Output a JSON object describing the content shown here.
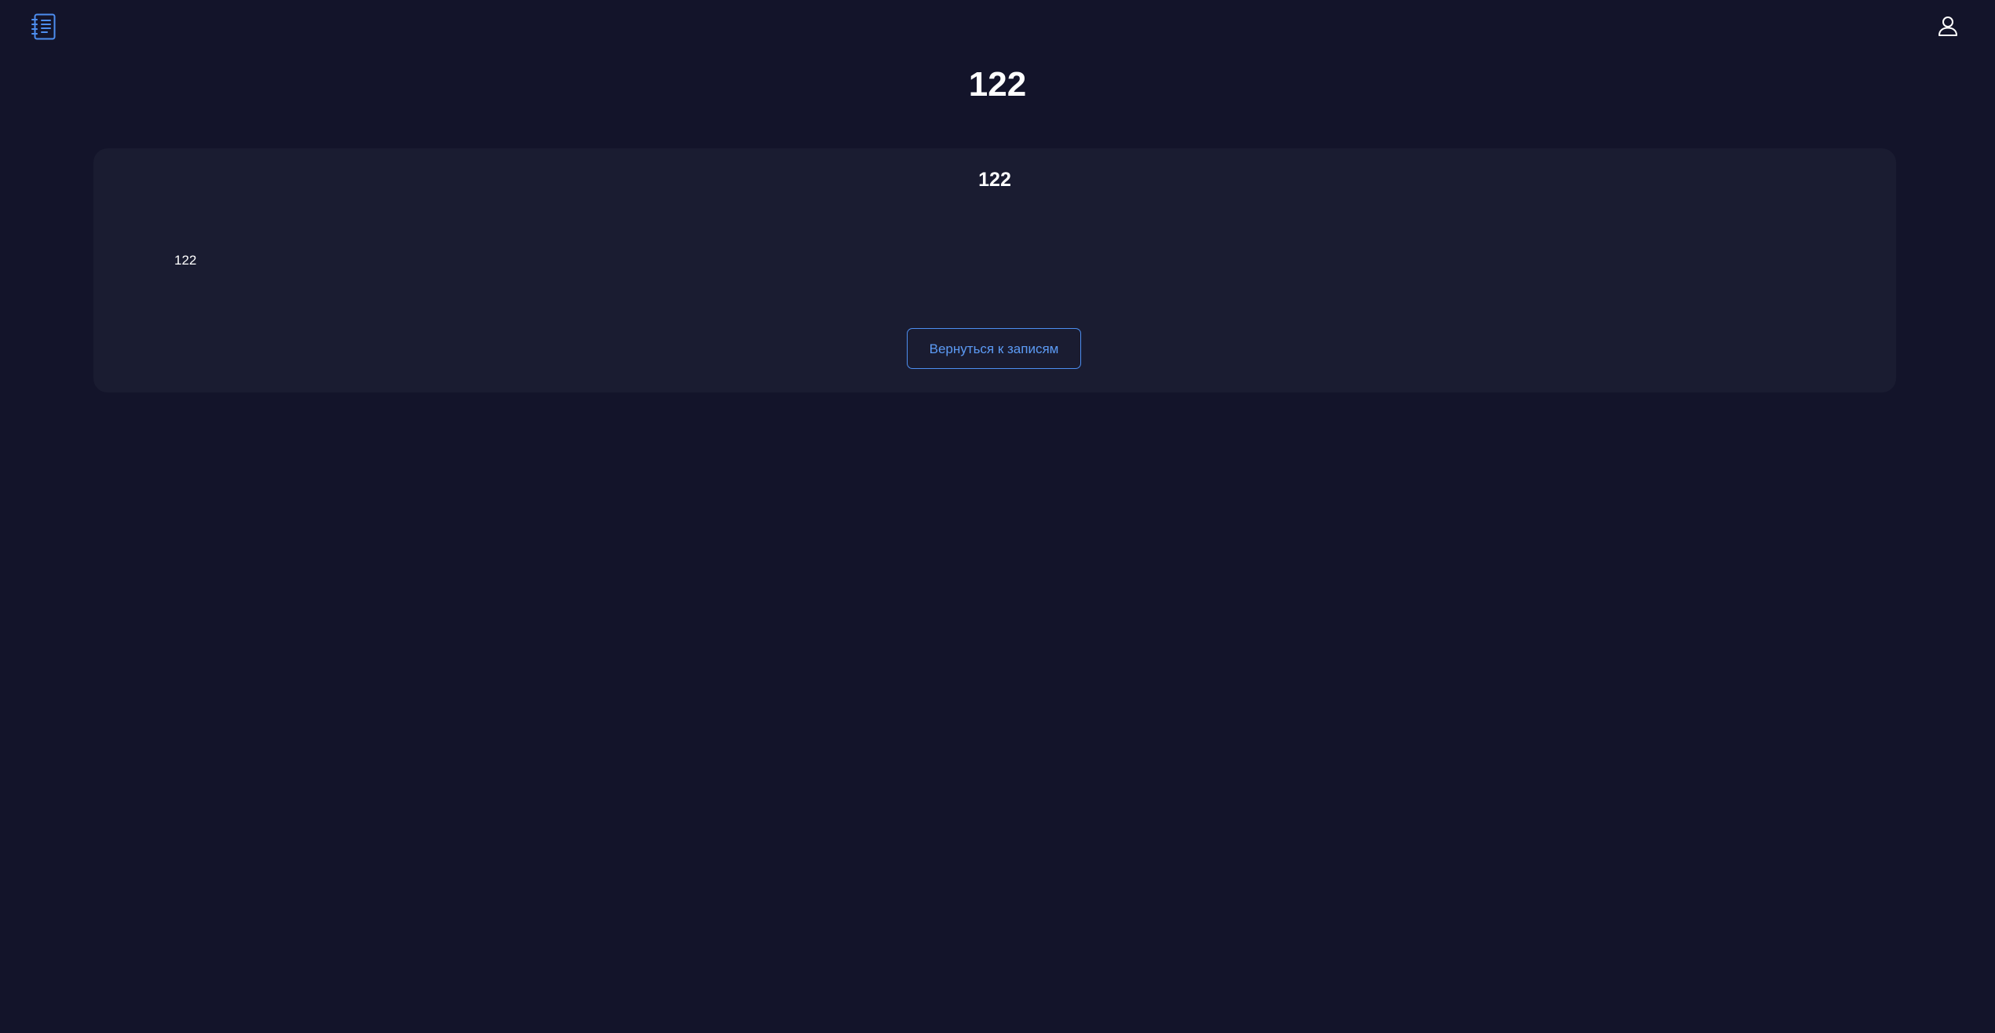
{
  "header": {
    "logo_icon": "notebook-list-icon",
    "profile_icon": "user-profile-icon"
  },
  "page": {
    "title": "122"
  },
  "note": {
    "title": "122",
    "body": "122",
    "back_button_label": "Вернуться к записям"
  },
  "colors": {
    "background": "#13142a",
    "card": "#1a1c31",
    "accent": "#4d8ef0",
    "text": "#ffffff"
  }
}
